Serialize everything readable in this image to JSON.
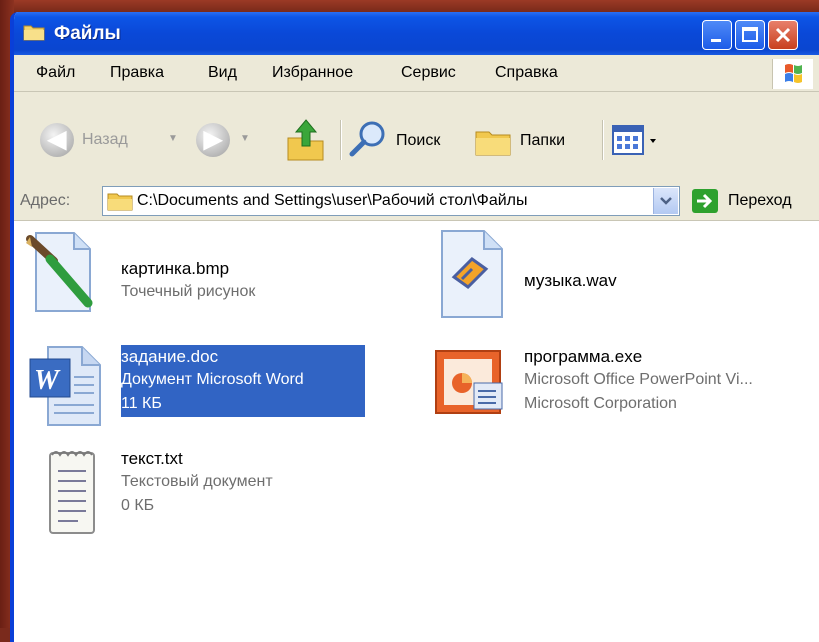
{
  "window": {
    "title": "Файлы"
  },
  "menu": [
    "Файл",
    "Правка",
    "Вид",
    "Избранное",
    "Сервис",
    "Справка"
  ],
  "toolbar": {
    "back": "Назад",
    "search": "Поиск",
    "folders": "Папки"
  },
  "address": {
    "label": "Адрес:",
    "path": "C:\\Documents and Settings\\user\\Рабочий стол\\Файлы",
    "go": "Переход"
  },
  "files": [
    {
      "name": "картинка.bmp",
      "line2": "Точечный рисунок",
      "line3": ""
    },
    {
      "name": "музыка.wav",
      "line2": "",
      "line3": ""
    },
    {
      "name": "задание.doc",
      "line2": "Документ Microsoft Word",
      "line3": "11 КБ",
      "selected": true
    },
    {
      "name": "программа.exe",
      "line2": "Microsoft Office PowerPoint Vi...",
      "line3": "Microsoft Corporation"
    },
    {
      "name": "текст.txt",
      "line2": "Текстовый документ",
      "line3": "0 КБ"
    }
  ],
  "colors": {
    "titlebar": "#0a48d8",
    "selection": "#3164c4",
    "chrome": "#ece9d8"
  },
  "icons": [
    "folder-icon",
    "minimize-icon",
    "maximize-icon",
    "close-icon",
    "windows-logo-icon",
    "back-icon",
    "forward-icon",
    "up-folder-icon",
    "search-icon",
    "folders-icon",
    "views-icon",
    "go-icon",
    "paint-icon",
    "media-icon",
    "word-icon",
    "powerpoint-icon",
    "notepad-icon"
  ]
}
